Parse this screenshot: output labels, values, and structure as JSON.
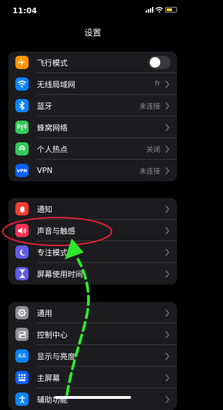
{
  "status": {
    "time": "11:04"
  },
  "title": "设置",
  "groups": [
    [
      {
        "label": "飞行模式",
        "icon": "airplane-icon",
        "color": "#ff9500",
        "toggle": true
      },
      {
        "label": "无线局域网",
        "icon": "wifi-icon",
        "color": "#0a84ff",
        "value": "fr"
      },
      {
        "label": "蓝牙",
        "icon": "bluetooth-icon",
        "color": "#0a84ff",
        "value": "未连接"
      },
      {
        "label": "蜂窝网络",
        "icon": "cellular-icon",
        "color": "#34c759",
        "value": ""
      },
      {
        "label": "个人热点",
        "icon": "hotspot-icon",
        "color": "#34c759",
        "value": "关闭"
      },
      {
        "label": "VPN",
        "icon": "vpn-icon",
        "color": "#0a60ff",
        "icon_text": "VPN",
        "value": "未连接"
      }
    ],
    [
      {
        "label": "通知",
        "icon": "notification-bell-icon",
        "color": "#ff3b30"
      },
      {
        "label": "声音与触感",
        "icon": "speaker-icon",
        "color": "#ff2d55"
      },
      {
        "label": "专注模式",
        "icon": "moon-icon",
        "color": "#5e5ce6"
      },
      {
        "label": "屏幕使用时间",
        "icon": "hourglass-icon",
        "color": "#5e5ce6"
      }
    ],
    [
      {
        "label": "通用",
        "icon": "gear-icon",
        "color": "#8e8e93"
      },
      {
        "label": "控制中心",
        "icon": "control-center-icon",
        "color": "#8e8e93"
      },
      {
        "label": "显示与亮度",
        "icon": "display-brightness-icon",
        "color": "#0a84ff",
        "icon_text": "AA"
      },
      {
        "label": "主屏幕",
        "icon": "home-screen-icon",
        "color": "#0a60ff"
      },
      {
        "label": "辅助功能",
        "icon": "accessibility-icon",
        "color": "#0a84ff"
      }
    ]
  ],
  "annotation": {
    "highlight_color": "#e0203a",
    "arrow_color": "#2ee82e"
  }
}
